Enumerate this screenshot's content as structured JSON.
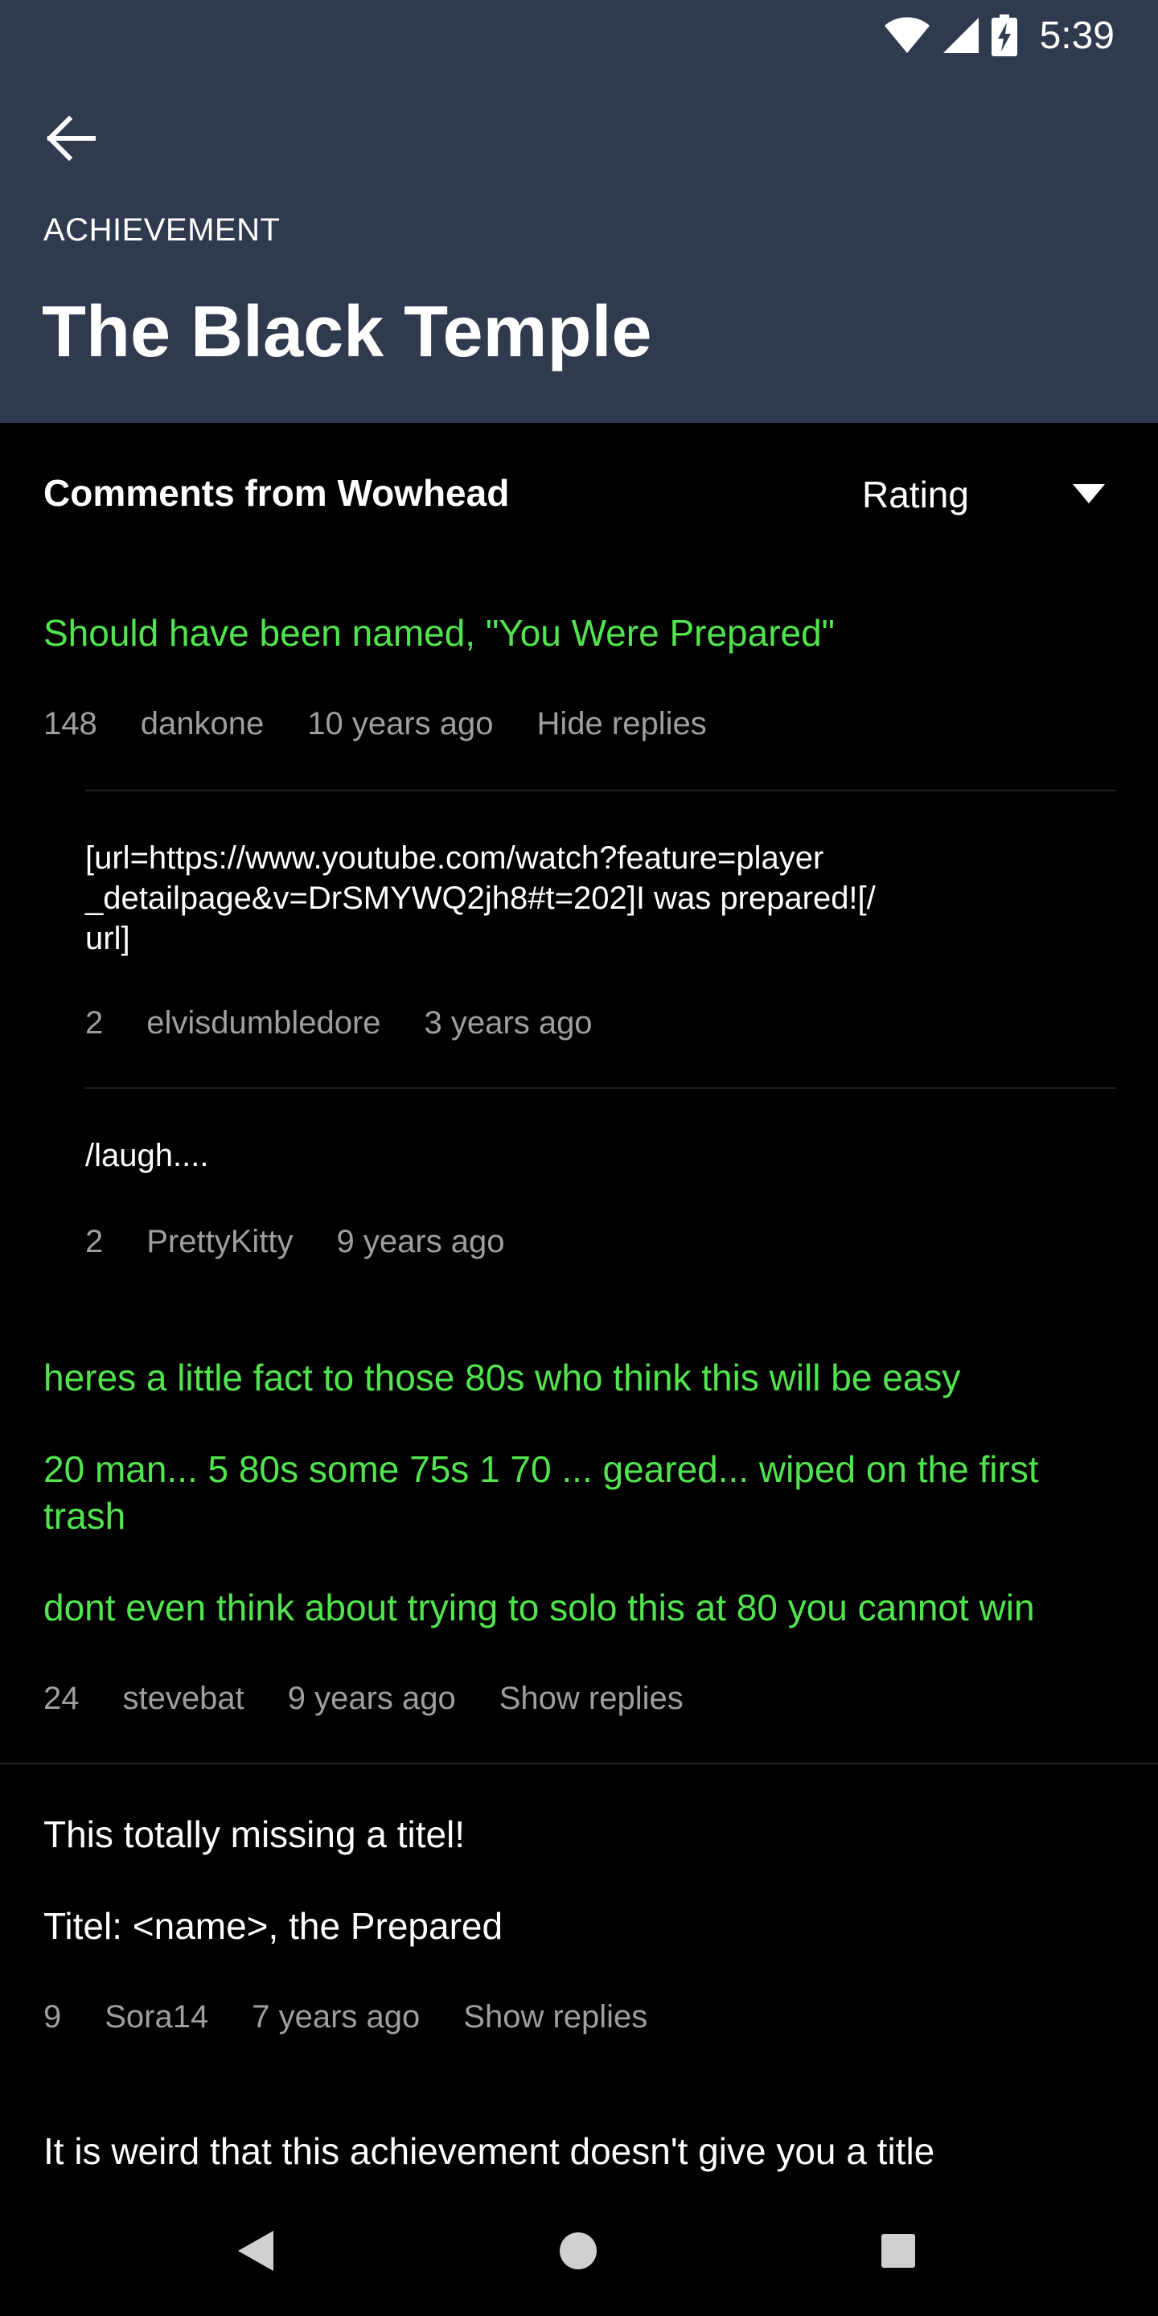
{
  "status_bar": {
    "time": "5:39",
    "icons": [
      "wifi-icon",
      "cell-signal-icon",
      "battery-charging-icon"
    ]
  },
  "header": {
    "back_icon": "arrow-left-icon",
    "kicker": "ACHIEVEMENT",
    "title": "The Black Temple"
  },
  "comments_header": {
    "title": "Comments from Wowhead",
    "sort_label": "Rating",
    "sort_icon": "dropdown-triangle-icon"
  },
  "comments": [
    {
      "text": "Should have been named, \"You Were Prepared\"",
      "rating": "148",
      "author": "dankone",
      "time": "10 years ago",
      "action": "Hide replies",
      "replies": [
        {
          "text_lines": [
            "[url=https://www.youtube.com/watch?feature=player",
            "_detailpage&v=DrSMYWQ2jh8#t=202]I was prepared![/",
            "url]"
          ],
          "rating": "2",
          "author": "elvisdumbledore",
          "time": "3 years ago"
        },
        {
          "text": "/laugh....",
          "rating": "2",
          "author": "PrettyKitty",
          "time": "9 years ago"
        }
      ]
    },
    {
      "paragraphs": [
        "heres a little fact to those 80s who think this will be easy",
        "20 man... 5 80s some 75s 1 70 ... geared... wiped on the first trash",
        "dont even think about trying to solo this at 80 you cannot win"
      ],
      "rating": "24",
      "author": "stevebat",
      "time": "9 years ago",
      "action": "Show replies"
    },
    {
      "paragraphs": [
        "This totally missing a titel!",
        "Titel: <name>, the Prepared"
      ],
      "rating": "9",
      "author": "Sora14",
      "time": "7 years ago",
      "action": "Show replies"
    },
    {
      "text": "It is weird that this achievement doesn't give you a title"
    }
  ],
  "nav_bar": {
    "icons": [
      "back-triangle-icon",
      "home-circle-icon",
      "recents-square-icon"
    ]
  },
  "colors": {
    "header_bg": "#2f3a4e",
    "highlight_green": "#52e44f",
    "meta_gray": "#9e9e9e"
  }
}
